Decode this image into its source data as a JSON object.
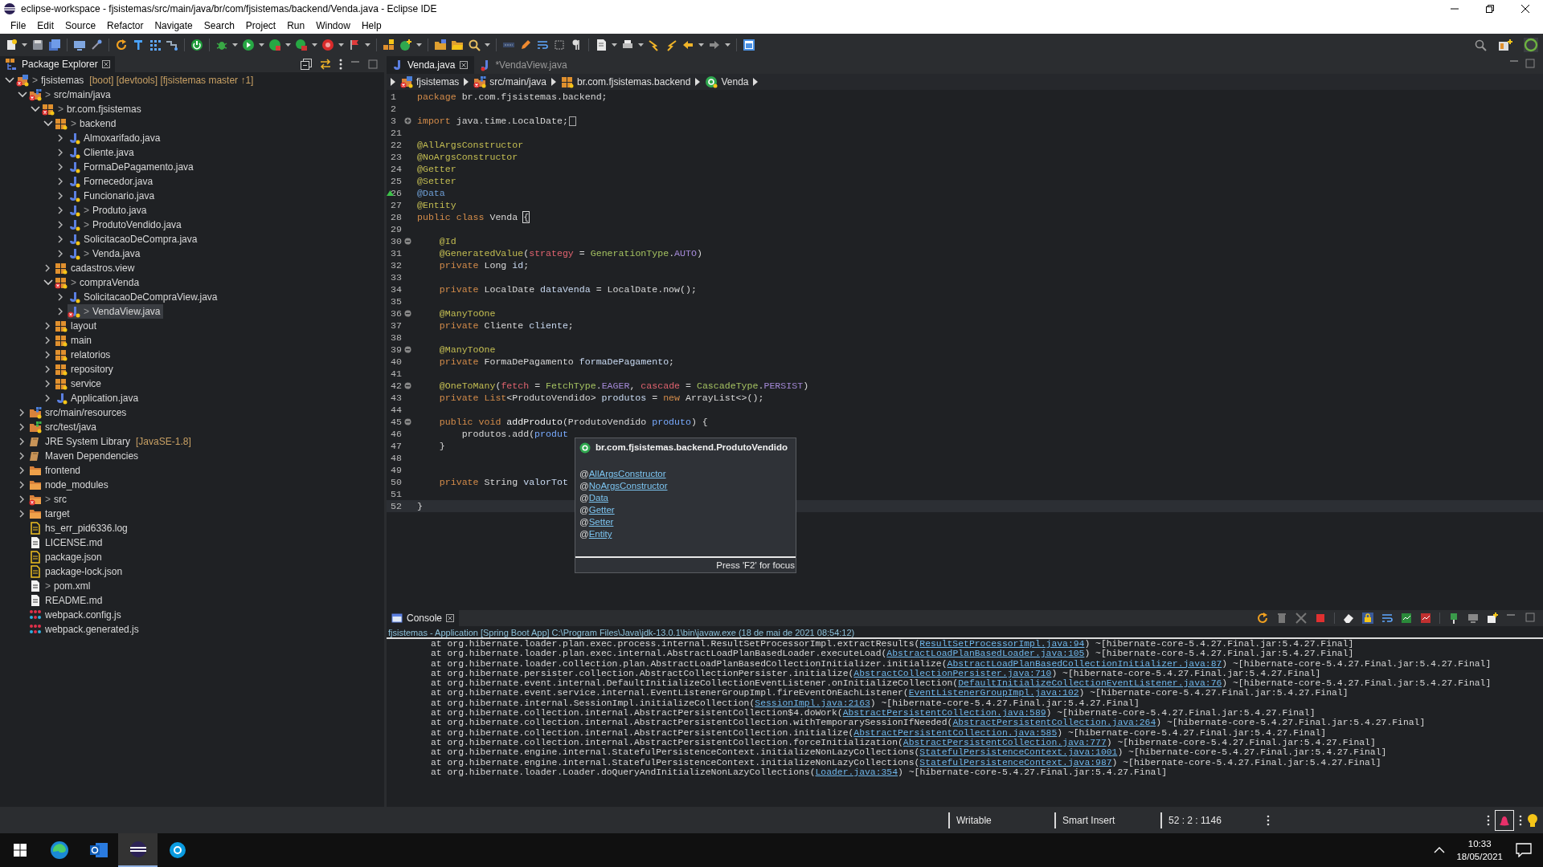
{
  "window": {
    "title": "eclipse-workspace - fjsistemas/src/main/java/br/com/fjsistemas/backend/Venda.java - Eclipse IDE"
  },
  "menu": [
    "File",
    "Edit",
    "Source",
    "Refactor",
    "Navigate",
    "Search",
    "Project",
    "Run",
    "Window",
    "Help"
  ],
  "explorer": {
    "title": "Package Explorer",
    "tree": [
      {
        "label": "fjsistemas",
        "prefix": ">",
        "suffix": "[boot] [devtools] [fjsistemas master ↑1]",
        "kind": "project",
        "error": true,
        "selected": false,
        "expanded": true,
        "children": [
          {
            "label": "src/main/java",
            "prefix": ">",
            "kind": "source",
            "error": true,
            "selected": false,
            "expanded": true,
            "children": [
              {
                "label": "br.com.fjsistemas",
                "prefix": ">",
                "kind": "package",
                "error": true,
                "selected": false,
                "expanded": true,
                "children": [
                  {
                    "label": "backend",
                    "prefix": ">",
                    "kind": "package",
                    "error": false,
                    "selected": false,
                    "expanded": true,
                    "children": [
                      {
                        "label": "Almoxarifado.java",
                        "kind": "java",
                        "error": false,
                        "selected": false,
                        "expanded": false
                      },
                      {
                        "label": "Cliente.java",
                        "kind": "java",
                        "error": false,
                        "selected": false,
                        "expanded": false
                      },
                      {
                        "label": "FormaDePagamento.java",
                        "kind": "java",
                        "error": false,
                        "selected": false,
                        "expanded": false
                      },
                      {
                        "label": "Fornecedor.java",
                        "kind": "java",
                        "error": false,
                        "selected": false,
                        "expanded": false
                      },
                      {
                        "label": "Funcionario.java",
                        "kind": "java",
                        "error": false,
                        "selected": false,
                        "expanded": false
                      },
                      {
                        "label": "Produto.java",
                        "prefix": ">",
                        "kind": "java",
                        "error": false,
                        "selected": false,
                        "expanded": false
                      },
                      {
                        "label": "ProdutoVendido.java",
                        "prefix": ">",
                        "kind": "java",
                        "error": false,
                        "selected": false,
                        "expanded": false
                      },
                      {
                        "label": "SolicitacaoDeCompra.java",
                        "kind": "java",
                        "error": false,
                        "selected": false,
                        "expanded": false
                      },
                      {
                        "label": "Venda.java",
                        "prefix": ">",
                        "kind": "java",
                        "error": false,
                        "selected": false,
                        "expanded": false
                      }
                    ]
                  },
                  {
                    "label": "cadastros.view",
                    "kind": "package",
                    "error": false,
                    "selected": false,
                    "expanded": false
                  },
                  {
                    "label": "compraVenda",
                    "prefix": ">",
                    "kind": "package",
                    "error": true,
                    "selected": false,
                    "expanded": true,
                    "children": [
                      {
                        "label": "SolicitacaoDeCompraView.java",
                        "kind": "java",
                        "error": false,
                        "selected": false,
                        "expanded": false
                      },
                      {
                        "label": "VendaView.java",
                        "prefix": ">",
                        "kind": "java",
                        "error": true,
                        "selected": true,
                        "expanded": false
                      }
                    ]
                  },
                  {
                    "label": "layout",
                    "kind": "package",
                    "error": false,
                    "selected": false,
                    "expanded": false
                  },
                  {
                    "label": "main",
                    "kind": "package",
                    "error": false,
                    "selected": false,
                    "expanded": false
                  },
                  {
                    "label": "relatorios",
                    "kind": "package",
                    "error": false,
                    "selected": false,
                    "expanded": false
                  },
                  {
                    "label": "repository",
                    "kind": "package",
                    "error": false,
                    "selected": false,
                    "expanded": false
                  },
                  {
                    "label": "service",
                    "kind": "package",
                    "error": false,
                    "selected": false,
                    "expanded": false
                  },
                  {
                    "label": "Application.java",
                    "kind": "java",
                    "error": false,
                    "selected": false,
                    "expanded": false
                  }
                ]
              }
            ]
          },
          {
            "label": "src/main/resources",
            "kind": "source",
            "error": false,
            "selected": false,
            "expanded": false
          },
          {
            "label": "src/test/java",
            "kind": "testsource",
            "error": false,
            "selected": false,
            "expanded": false
          },
          {
            "label": "JRE System Library",
            "suffix": "[JavaSE-1.8]",
            "kind": "library",
            "error": false,
            "selected": false,
            "expanded": false
          },
          {
            "label": "Maven Dependencies",
            "kind": "library",
            "error": false,
            "selected": false,
            "expanded": false
          },
          {
            "label": "frontend",
            "kind": "folder",
            "error": false,
            "selected": false,
            "expanded": false
          },
          {
            "label": "node_modules",
            "kind": "folder",
            "error": false,
            "selected": false,
            "expanded": false
          },
          {
            "label": "src",
            "prefix": ">",
            "kind": "folder",
            "error": true,
            "selected": false,
            "expanded": false
          },
          {
            "label": "target",
            "kind": "folder",
            "error": false,
            "selected": false,
            "expanded": false
          },
          {
            "label": "hs_err_pid6336.log",
            "kind": "yellowdoc",
            "error": false,
            "selected": false
          },
          {
            "label": "LICENSE.md",
            "kind": "doc",
            "error": false,
            "selected": false
          },
          {
            "label": "package.json",
            "kind": "yellowdoc",
            "error": false,
            "selected": false
          },
          {
            "label": "package-lock.json",
            "kind": "yellowdoc",
            "error": false,
            "selected": false
          },
          {
            "label": "pom.xml",
            "prefix": ">",
            "kind": "doc",
            "error": false,
            "selected": false
          },
          {
            "label": "README.md",
            "kind": "doc",
            "error": false,
            "selected": false
          },
          {
            "label": "webpack.config.js",
            "kind": "dots",
            "error": false,
            "selected": false
          },
          {
            "label": "webpack.generated.js",
            "kind": "dots",
            "error": false,
            "selected": false
          }
        ]
      }
    ]
  },
  "editor": {
    "tabs": [
      {
        "label": "Venda.java",
        "selected": true,
        "error": false
      },
      {
        "label": "*VendaView.java",
        "selected": false,
        "error": true
      }
    ],
    "breadcrumb": [
      {
        "label": "fjsistemas",
        "kind": "project"
      },
      {
        "label": "src/main/java",
        "kind": "source"
      },
      {
        "label": "br.com.fjsistemas.backend",
        "kind": "package"
      },
      {
        "label": "Venda",
        "kind": "class"
      }
    ],
    "lines": [
      {
        "n": "1",
        "current": false,
        "segs": [
          {
            "kind": "kw",
            "text": "package"
          },
          {
            "kind": "pl",
            "text": " br.com.fjsistemas.backend;"
          }
        ]
      },
      {
        "n": "2",
        "current": false
      },
      {
        "n": "3",
        "expanded": false,
        "current": false,
        "segs": [
          {
            "kind": "kw",
            "text": "import"
          },
          {
            "kind": "pl",
            "text": " java.time.LocalDate;"
          }
        ]
      },
      {
        "n": "21",
        "current": false
      },
      {
        "n": "22",
        "current": false,
        "segs": [
          {
            "kind": "ann",
            "text": "@AllArgsConstructor"
          }
        ]
      },
      {
        "n": "23",
        "current": false,
        "segs": [
          {
            "kind": "ann",
            "text": "@NoArgsConstructor"
          }
        ]
      },
      {
        "n": "24",
        "current": false,
        "segs": [
          {
            "kind": "ann",
            "text": "@Getter"
          }
        ]
      },
      {
        "n": "25",
        "current": false,
        "segs": [
          {
            "kind": "ann",
            "text": "@Setter"
          }
        ]
      },
      {
        "n": "26",
        "override": true,
        "current": false,
        "segs": [
          {
            "kind": "lnk",
            "text": "@Data"
          }
        ]
      },
      {
        "n": "27",
        "current": false,
        "segs": [
          {
            "kind": "ann",
            "text": "@Entity"
          }
        ]
      },
      {
        "n": "28",
        "current": false,
        "segs": [
          {
            "kind": "kw",
            "text": "public"
          },
          {
            "kind": "kw",
            "text": " class"
          },
          {
            "kind": "pl",
            "text": " Venda "
          },
          {
            "kind": "brk",
            "text": "{"
          }
        ]
      },
      {
        "n": "29",
        "current": false
      },
      {
        "n": "30",
        "expanded": true,
        "current": false,
        "segs": [
          {
            "kind": "ann",
            "text": "    @Id"
          }
        ]
      },
      {
        "n": "31",
        "current": false,
        "segs": [
          {
            "kind": "ann",
            "text": "    @GeneratedValue"
          },
          {
            "kind": "pl",
            "text": "("
          },
          {
            "kind": "arg",
            "text": "strategy"
          },
          {
            "kind": "pl",
            "text": " = "
          },
          {
            "kind": "cls",
            "text": "GenerationType"
          },
          {
            "kind": "pl",
            "text": "."
          },
          {
            "kind": "cst",
            "text": "AUTO"
          },
          {
            "kind": "pl",
            "text": ")"
          }
        ]
      },
      {
        "n": "32",
        "current": false,
        "segs": [
          {
            "kind": "kw",
            "text": "    private"
          },
          {
            "kind": "pl",
            "text": " Long "
          },
          {
            "kind": "fld",
            "text": "id"
          },
          {
            "kind": "pl",
            "text": ";"
          }
        ]
      },
      {
        "n": "33",
        "current": false
      },
      {
        "n": "34",
        "current": false,
        "segs": [
          {
            "kind": "kw",
            "text": "    private"
          },
          {
            "kind": "pl",
            "text": " LocalDate "
          },
          {
            "kind": "fld",
            "text": "dataVenda"
          },
          {
            "kind": "pl",
            "text": " = LocalDate.now();"
          }
        ]
      },
      {
        "n": "35",
        "current": false
      },
      {
        "n": "36",
        "expanded": true,
        "current": false,
        "segs": [
          {
            "kind": "ann",
            "text": "    @ManyToOne"
          }
        ]
      },
      {
        "n": "37",
        "current": false,
        "segs": [
          {
            "kind": "kw",
            "text": "    private"
          },
          {
            "kind": "pl",
            "text": " Cliente "
          },
          {
            "kind": "fld",
            "text": "cliente"
          },
          {
            "kind": "pl",
            "text": ";"
          }
        ]
      },
      {
        "n": "38",
        "current": false
      },
      {
        "n": "39",
        "expanded": true,
        "current": false,
        "segs": [
          {
            "kind": "ann",
            "text": "    @ManyToOne"
          }
        ]
      },
      {
        "n": "40",
        "current": false,
        "segs": [
          {
            "kind": "kw",
            "text": "    private"
          },
          {
            "kind": "pl",
            "text": " FormaDePagamento "
          },
          {
            "kind": "fld",
            "text": "formaDePagamento"
          },
          {
            "kind": "pl",
            "text": ";"
          }
        ]
      },
      {
        "n": "41",
        "current": false
      },
      {
        "n": "42",
        "expanded": true,
        "current": false,
        "segs": [
          {
            "kind": "ann",
            "text": "    @OneToMany"
          },
          {
            "kind": "pl",
            "text": "("
          },
          {
            "kind": "arg",
            "text": "fetch"
          },
          {
            "kind": "pl",
            "text": " = "
          },
          {
            "kind": "cls",
            "text": "FetchType"
          },
          {
            "kind": "pl",
            "text": "."
          },
          {
            "kind": "cst",
            "text": "EAGER"
          },
          {
            "kind": "pl",
            "text": ", "
          },
          {
            "kind": "arg",
            "text": "cascade"
          },
          {
            "kind": "pl",
            "text": " = "
          },
          {
            "kind": "cls",
            "text": "CascadeType"
          },
          {
            "kind": "pl",
            "text": "."
          },
          {
            "kind": "cst",
            "text": "PERSIST"
          },
          {
            "kind": "pl",
            "text": ")"
          }
        ]
      },
      {
        "n": "43",
        "current": false,
        "segs": [
          {
            "kind": "kw",
            "text": "    private"
          },
          {
            "kind": "kw",
            "text": " List"
          },
          {
            "kind": "pl",
            "text": "<ProdutoVendido> "
          },
          {
            "kind": "fld",
            "text": "produtos"
          },
          {
            "kind": "pl",
            "text": " = "
          },
          {
            "kind": "kw",
            "text": "new"
          },
          {
            "kind": "pl",
            "text": " ArrayList<>();"
          }
        ]
      },
      {
        "n": "44",
        "current": false
      },
      {
        "n": "45",
        "expanded": true,
        "current": false,
        "segs": [
          {
            "kind": "kw",
            "text": "    public"
          },
          {
            "kind": "kw",
            "text": " void"
          },
          {
            "kind": "mth",
            "text": " addProduto"
          },
          {
            "kind": "pl",
            "text": "(ProdutoVendido "
          },
          {
            "kind": "par",
            "text": "produto"
          },
          {
            "kind": "pl",
            "text": ") {"
          }
        ]
      },
      {
        "n": "46",
        "current": false,
        "segs": [
          {
            "kind": "pl",
            "text": "        produtos.add("
          },
          {
            "kind": "par",
            "text": "produt"
          }
        ]
      },
      {
        "n": "47",
        "current": false,
        "segs": [
          {
            "kind": "pl",
            "text": "    }"
          }
        ]
      },
      {
        "n": "48",
        "current": false
      },
      {
        "n": "49",
        "current": false
      },
      {
        "n": "50",
        "current": false,
        "segs": [
          {
            "kind": "kw",
            "text": "    private"
          },
          {
            "kind": "pl",
            "text": " String "
          },
          {
            "kind": "fld",
            "text": "valorTot"
          }
        ]
      },
      {
        "n": "51",
        "current": false
      },
      {
        "n": "52",
        "current": true,
        "segs": [
          {
            "kind": "pl",
            "text": "}"
          }
        ]
      }
    ],
    "hover": {
      "title": "br.com.fjsistemas.backend.ProdutoVendido",
      "items": [
        {
          "prefix": "@",
          "link": "AllArgsConstructor"
        },
        {
          "prefix": "@",
          "link": "NoArgsConstructor"
        },
        {
          "prefix": "@",
          "link": "Data"
        },
        {
          "prefix": "@",
          "link": "Getter"
        },
        {
          "prefix": "@",
          "link": "Setter"
        },
        {
          "prefix": "@",
          "link": "Entity"
        }
      ],
      "footer": "Press 'F2' for focus"
    }
  },
  "console": {
    "title": "Console",
    "launch": "fjsistemas - Application [Spring Boot App] C:\\Program Files\\Java\\jdk-13.0.1\\bin\\javaw.exe  (18 de mai de 2021 08:54:12)",
    "lines": [
      {
        "text": "at org.hibernate.loader.plan.exec.process.internal.ResultSetProcessorImpl.extractResults(",
        "link": "ResultSetProcessorImpl.java:94",
        "suffix": ") ~[hibernate-core-5.4.27.Final.jar:5.4.27.Final]"
      },
      {
        "text": "at org.hibernate.loader.plan.exec.internal.AbstractLoadPlanBasedLoader.executeLoad(",
        "link": "AbstractLoadPlanBasedLoader.java:105",
        "suffix": ") ~[hibernate-core-5.4.27.Final.jar:5.4.27.Final]"
      },
      {
        "text": "at org.hibernate.loader.collection.plan.AbstractLoadPlanBasedCollectionInitializer.initialize(",
        "link": "AbstractLoadPlanBasedCollectionInitializer.java:87",
        "suffix": ") ~[hibernate-core-5.4.27.Final.jar:5.4.27.Final]"
      },
      {
        "text": "at org.hibernate.persister.collection.AbstractCollectionPersister.initialize(",
        "link": "AbstractCollectionPersister.java:710",
        "suffix": ") ~[hibernate-core-5.4.27.Final.jar:5.4.27.Final]"
      },
      {
        "text": "at org.hibernate.event.internal.DefaultInitializeCollectionEventListener.onInitializeCollection(",
        "link": "DefaultInitializeCollectionEventListener.java:76",
        "suffix": ") ~[hibernate-core-5.4.27.Final.jar:5.4.27.Final]"
      },
      {
        "text": "at org.hibernate.event.service.internal.EventListenerGroupImpl.fireEventOnEachListener(",
        "link": "EventListenerGroupImpl.java:102",
        "suffix": ") ~[hibernate-core-5.4.27.Final.jar:5.4.27.Final]"
      },
      {
        "text": "at org.hibernate.internal.SessionImpl.initializeCollection(",
        "link": "SessionImpl.java:2163",
        "suffix": ") ~[hibernate-core-5.4.27.Final.jar:5.4.27.Final]"
      },
      {
        "text": "at org.hibernate.collection.internal.AbstractPersistentCollection$4.doWork(",
        "link": "AbstractPersistentCollection.java:589",
        "suffix": ") ~[hibernate-core-5.4.27.Final.jar:5.4.27.Final]"
      },
      {
        "text": "at org.hibernate.collection.internal.AbstractPersistentCollection.withTemporarySessionIfNeeded(",
        "link": "AbstractPersistentCollection.java:264",
        "suffix": ") ~[hibernate-core-5.4.27.Final.jar:5.4.27.Final]"
      },
      {
        "text": "at org.hibernate.collection.internal.AbstractPersistentCollection.initialize(",
        "link": "AbstractPersistentCollection.java:585",
        "suffix": ") ~[hibernate-core-5.4.27.Final.jar:5.4.27.Final]"
      },
      {
        "text": "at org.hibernate.collection.internal.AbstractPersistentCollection.forceInitialization(",
        "link": "AbstractPersistentCollection.java:777",
        "suffix": ") ~[hibernate-core-5.4.27.Final.jar:5.4.27.Final]"
      },
      {
        "text": "at org.hibernate.engine.internal.StatefulPersistenceContext.initializeNonLazyCollections(",
        "link": "StatefulPersistenceContext.java:1001",
        "suffix": ") ~[hibernate-core-5.4.27.Final.jar:5.4.27.Final]"
      },
      {
        "text": "at org.hibernate.engine.internal.StatefulPersistenceContext.initializeNonLazyCollections(",
        "link": "StatefulPersistenceContext.java:987",
        "suffix": ") ~[hibernate-core-5.4.27.Final.jar:5.4.27.Final]"
      },
      {
        "text": "at org.hibernate.loader.Loader.doQueryAndInitializeNonLazyCollections(",
        "link": "Loader.java:354",
        "suffix": ") ~[hibernate-core-5.4.27.Final.jar:5.4.27.Final]"
      }
    ]
  },
  "status_bar": [
    "Writable",
    "Smart Insert",
    "52 : 2 : 1146"
  ],
  "taskbar": {
    "apps": [
      {
        "kind": "edge",
        "selected": false
      },
      {
        "kind": "outlook",
        "selected": false
      },
      {
        "kind": "eclipse",
        "selected": true
      },
      {
        "kind": "skype",
        "selected": false
      }
    ],
    "time": "10:33",
    "date": "18/05/2021"
  }
}
